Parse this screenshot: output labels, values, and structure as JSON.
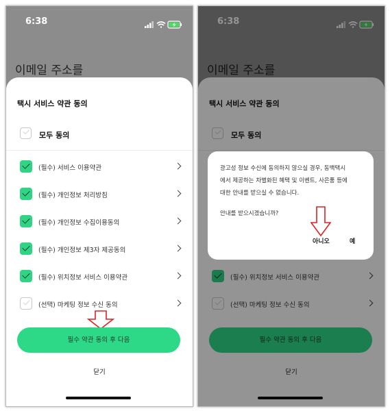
{
  "left_screen": {
    "status": {
      "time": "6:38"
    },
    "behind_title": "이메일 주소를",
    "sheet": {
      "title": "택시 서비스 약관 동의",
      "all_agree": "모두 동의",
      "terms": [
        {
          "label": "(필수) 서비스 이용약관",
          "checked": true
        },
        {
          "label": "(필수) 개인정보 처리방침",
          "checked": true
        },
        {
          "label": "(필수) 개인정보 수집이용동의",
          "checked": true
        },
        {
          "label": "(필수) 개인정보 제3자  제공동의",
          "checked": true
        },
        {
          "label": "(필수) 위치정보 서비스 이용약관",
          "checked": true
        },
        {
          "label": "(선택) 마케팅 정보 수신 동의",
          "checked": false
        }
      ],
      "primary_button": "필수 약관 동의 후 다음",
      "close_button": "닫기"
    }
  },
  "right_screen": {
    "status": {
      "time": "6:38"
    },
    "behind_title": "이메일 주소를",
    "sheet": {
      "title": "택시 서비스 약관 동의",
      "all_agree": "모두 동의",
      "terms": [
        {
          "label": "(필수) 위치정보 서비스 이용약관",
          "checked": true
        },
        {
          "label": "(선택) 마케팅 정보 수신 동의",
          "checked": false
        }
      ],
      "primary_button": "필수 약관 동의 후 다음",
      "close_button": "닫기"
    },
    "dialog": {
      "message_lines": [
        "광고성 정보 수신에 동의하지 않으실 경우, 동백택시",
        "에서 제공하는 차별화된 혜택 및 이벤트, 사은품 등에",
        "대한 안내를 받으실 수 없습니다."
      ],
      "question": "안내를 받으시겠습니까?",
      "no_button": "아니오",
      "yes_button": "예"
    }
  },
  "colors": {
    "accent_green": "#2dd987",
    "annotation_red": "#e02020",
    "background_gray": "#8c8c8c"
  },
  "icons": {
    "status": [
      "signal-icon",
      "wifi-icon",
      "battery-charging-icon"
    ],
    "annotation": "red-down-arrow"
  }
}
